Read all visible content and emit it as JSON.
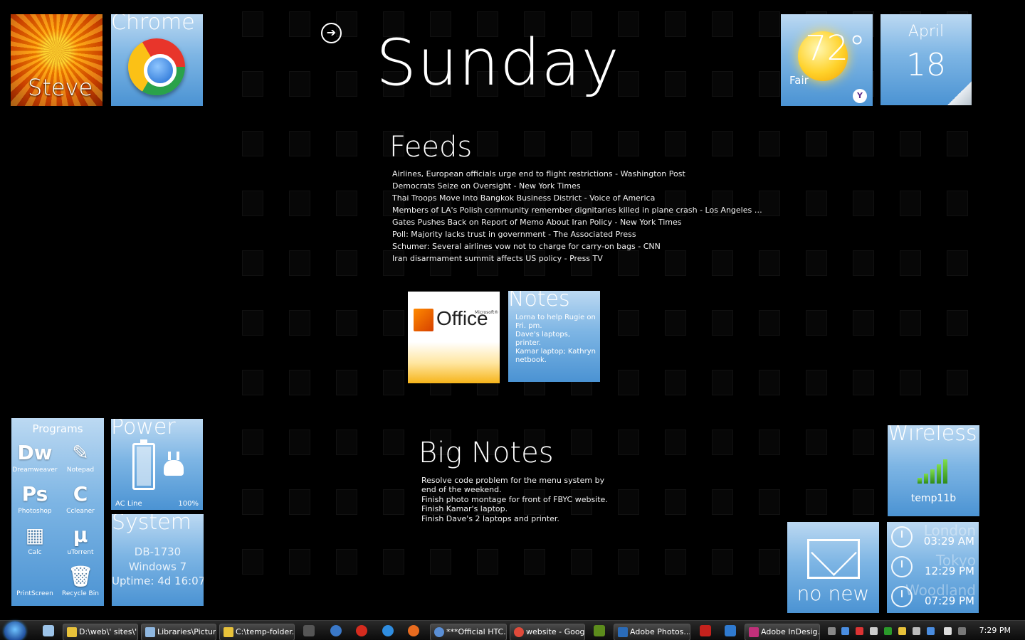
{
  "tiles": {
    "user": {
      "label": "Steve"
    },
    "chrome": {
      "title": "Chrome"
    },
    "weather": {
      "temp": "72°",
      "condition": "Fair",
      "provider_badge": "Y"
    },
    "calendar": {
      "month": "April",
      "day": "18"
    },
    "office": {
      "word": "Office",
      "microsoft": "Microsoft®"
    },
    "notes": {
      "title": "Notes",
      "body": "Lorna to help Rugie on Fri. pm.\nDave's laptops, printer.\nKamar laptop; Kathryn netbook."
    },
    "programs": {
      "title": "Programs",
      "items": [
        {
          "glyph": "Dw",
          "name": "Dreamweaver"
        },
        {
          "glyph": "✎",
          "name": "Notepad"
        },
        {
          "glyph": "Ps",
          "name": "Photoshop"
        },
        {
          "glyph": "C",
          "name": "Ccleaner"
        },
        {
          "glyph": "▦",
          "name": "Calc"
        },
        {
          "glyph": "μ",
          "name": "uTorrent"
        },
        {
          "glyph": "",
          "name": "PrintScreen"
        },
        {
          "glyph": "🗑",
          "name": "Recycle Bin"
        }
      ]
    },
    "power": {
      "title": "Power",
      "source": "AC Line",
      "percent": "100%",
      "battery_level": 1.0
    },
    "system": {
      "title": "System",
      "computer": "DB-1730",
      "os": "Windows 7",
      "uptime": "Uptime: 4d 16:07"
    },
    "wireless": {
      "title": "Wireless",
      "ssid": "temp11b",
      "signal_bars": 5
    },
    "mail": {
      "status": "no new"
    },
    "clocks": [
      {
        "city": "London",
        "time": "03:29 AM"
      },
      {
        "city": "Tokyo",
        "time": "12:29 PM"
      },
      {
        "city": "Woodland",
        "time": "07:29 PM"
      }
    ]
  },
  "header": {
    "day": "Sunday",
    "nav_arrow": "➔"
  },
  "feeds": {
    "heading": "Feeds",
    "items": [
      "Airlines, European officials urge end to flight restrictions - Washington Post",
      "Democrats Seize on Oversight - New York Times",
      "Thai Troops Move Into Bangkok Business District - Voice of America",
      "Members of LA's Polish community remember dignitaries killed in plane crash - Los Angeles Ti...",
      "Gates Pushes Back on Report of Memo About Iran Policy - New York Times",
      "Poll: Majority lacks trust in government - The Associated Press",
      "Schumer: Several airlines vow not to charge for carry-on bags - CNN",
      "Iran disarmament summit affects US policy - Press TV"
    ]
  },
  "big_notes": {
    "heading": "Big Notes",
    "body": "Resolve code problem for the menu system by end of the weekend.\nFinish photo montage for front of FBYC website.\nFinish Kamar's laptop.\nFinish Dave's 2 laptops and printer."
  },
  "taskbar": {
    "buttons": [
      {
        "label": "D:\\web\\' sites\\'...",
        "color": "#e8c23a"
      },
      {
        "label": "Libraries\\Pictur...",
        "color": "#8fb7e0"
      },
      {
        "label": "C:\\temp-folder...",
        "color": "#e8c23a"
      },
      {
        "label": "***Official HTC...",
        "color": "#5a8fd6"
      },
      {
        "label": "website - Goog...",
        "color": "#e04a3a"
      },
      {
        "label": "Adobe Photos...",
        "color": "#2a6bb8"
      },
      {
        "label": "Adobe InDesig...",
        "color": "#c0307a"
      }
    ],
    "clock": "7:29 PM"
  },
  "colors": {
    "tile_blue": "#4b93d3",
    "background": "#000000"
  }
}
